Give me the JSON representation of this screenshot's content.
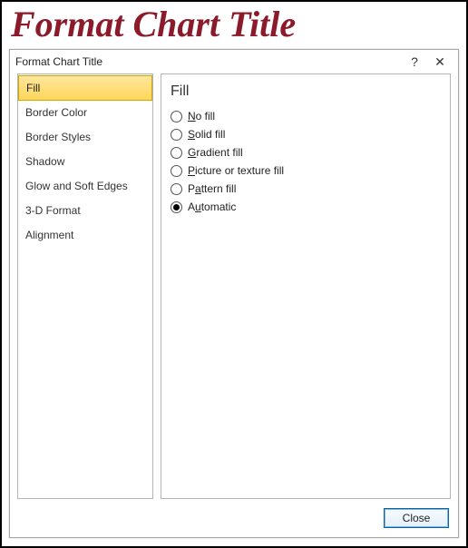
{
  "page": {
    "heading": "Format Chart Title"
  },
  "dialog": {
    "title": "Format Chart Title",
    "help_label": "?",
    "close_label": "✕",
    "close_button": "Close"
  },
  "sidebar": {
    "items": [
      {
        "label": "Fill",
        "selected": true
      },
      {
        "label": "Border Color",
        "selected": false
      },
      {
        "label": "Border Styles",
        "selected": false
      },
      {
        "label": "Shadow",
        "selected": false
      },
      {
        "label": "Glow and Soft Edges",
        "selected": false
      },
      {
        "label": "3-D Format",
        "selected": false
      },
      {
        "label": "Alignment",
        "selected": false
      }
    ]
  },
  "content": {
    "heading": "Fill",
    "options": [
      {
        "label": "No fill",
        "accel": "N",
        "selected": false
      },
      {
        "label": "Solid fill",
        "accel": "S",
        "selected": false
      },
      {
        "label": "Gradient fill",
        "accel": "G",
        "selected": false
      },
      {
        "label": "Picture or texture fill",
        "accel": "P",
        "selected": false
      },
      {
        "label": "Pattern fill",
        "accel": "A",
        "selected": false
      },
      {
        "label": "Automatic",
        "accel": "U",
        "selected": true
      }
    ]
  }
}
